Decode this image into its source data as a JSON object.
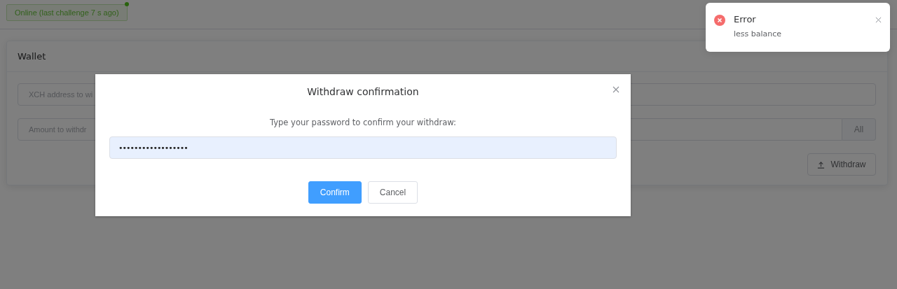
{
  "status": {
    "label": "Online (last challenge 7 s ago)",
    "online": true
  },
  "wallet": {
    "title": "Wallet",
    "address_field": {
      "placeholder": "XCH address to wi"
    },
    "amount_field": {
      "placeholder": "Amount to withdr",
      "addon": "All"
    },
    "withdraw_button": "Withdraw"
  },
  "dialog": {
    "title": "Withdraw confirmation",
    "message": "Type your password to confirm your withdraw:",
    "password": "••••••••••••••••••",
    "buttons": [
      {
        "label": "Confirm",
        "kind": "primary"
      },
      {
        "label": "Cancel",
        "kind": "default"
      }
    ]
  },
  "toast": {
    "kind": "error",
    "title": "Error",
    "message": "less balance"
  }
}
